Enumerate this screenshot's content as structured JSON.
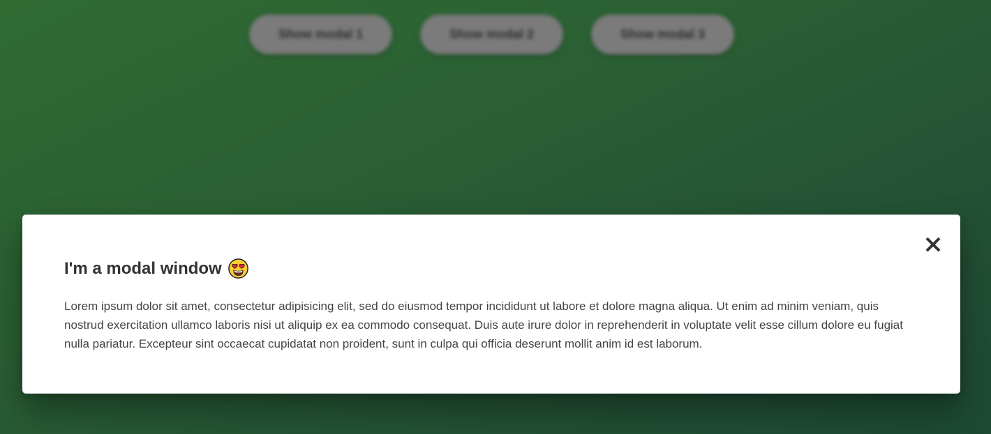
{
  "background": {
    "buttons": [
      {
        "label": "Show modal 1"
      },
      {
        "label": "Show modal 2"
      },
      {
        "label": "Show modal 3"
      }
    ]
  },
  "modal": {
    "title": "I'm a modal window",
    "title_emoji_icon": "heart-eyes-emoji-icon",
    "body": "Lorem ipsum dolor sit amet, consectetur adipisicing elit, sed do eiusmod tempor incididunt ut labore et dolore magna aliqua. Ut enim ad minim veniam, quis nostrud exercitation ullamco laboris nisi ut aliquip ex ea commodo consequat. Duis aute irure dolor in reprehenderit in voluptate velit esse cillum dolore eu fugiat nulla pariatur. Excepteur sint occaecat cupidatat non proident, sunt in culpa qui officia deserunt mollit anim id est laborum.",
    "close_icon": "close-icon"
  },
  "colors": {
    "background_start": "#2f6b33",
    "background_end": "#1d4a35",
    "modal_bg": "#ffffff",
    "button_bg": "#7b7b7b",
    "text_dark": "#333333"
  }
}
